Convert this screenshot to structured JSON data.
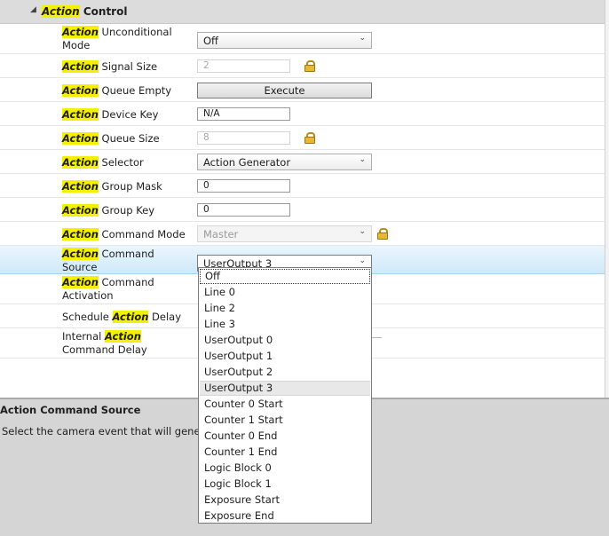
{
  "category": {
    "keyword": "Action",
    "rest": " Control"
  },
  "properties": [
    {
      "kw": "Action",
      "line1": " Unconditional",
      "line2": "Mode",
      "editor": "combo",
      "value": "Off"
    },
    {
      "kw": "Action",
      "line1": " Signal Size",
      "editor": "text",
      "value": "2",
      "disabled": true,
      "locked": true
    },
    {
      "kw": "Action",
      "line1": " Queue Empty",
      "editor": "button",
      "value": "Execute"
    },
    {
      "kw": "Action",
      "line1": " Device Key",
      "editor": "text",
      "value": "N/A"
    },
    {
      "kw": "Action",
      "line1": " Queue Size",
      "editor": "text",
      "value": "8",
      "disabled": true,
      "locked": true
    },
    {
      "kw": "Action",
      "line1": " Selector",
      "editor": "combo",
      "value": "Action Generator"
    },
    {
      "kw": "Action",
      "line1": " Group Mask",
      "editor": "text",
      "value": "0"
    },
    {
      "kw": "Action",
      "line1": " Group Key",
      "editor": "text",
      "value": "0"
    },
    {
      "kw": "Action",
      "line1": " Command Mode",
      "editor": "combo",
      "value": "Master",
      "disabled": true,
      "locked": true
    },
    {
      "kw": "Action",
      "line1": " Command",
      "line2": "Source",
      "editor": "combo",
      "value": "UserOutput 3",
      "selected": true,
      "open": true
    },
    {
      "kw": "Action",
      "line1": " Command",
      "line2": "Activation"
    },
    {
      "pre": "Schedule ",
      "kw": "Action",
      "line1": " Delay"
    },
    {
      "pre": "Internal ",
      "kw": "Action",
      "line2": "Command Delay",
      "slider": true
    }
  ],
  "dropdown_options": [
    "Off",
    "Line 0",
    "Line 2",
    "Line 3",
    "UserOutput 0",
    "UserOutput 1",
    "UserOutput 2",
    "UserOutput 3",
    "Counter 0 Start",
    "Counter 1 Start",
    "Counter 0 End",
    "Counter 1 End",
    "Logic Block 0",
    "Logic Block 1",
    "Exposure Start",
    "Exposure End"
  ],
  "dropdown_focused": "Off",
  "dropdown_current": "UserOutput 3",
  "description": {
    "title": "Action Command Source",
    "text": "Select the camera event that will generate"
  }
}
